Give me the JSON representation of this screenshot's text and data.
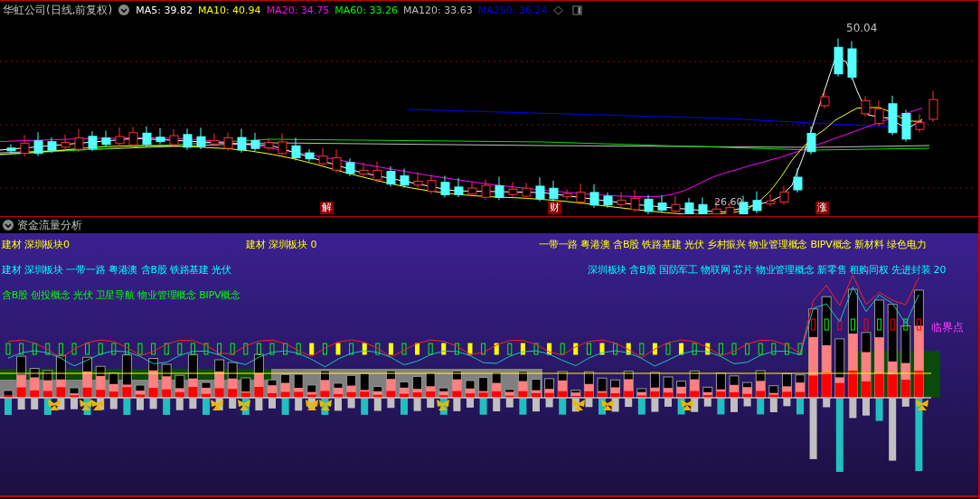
{
  "header": {
    "title": "华虹公司(日线,前复权)",
    "ma": [
      {
        "label": "MA5: 39.82",
        "color": "#ffffff"
      },
      {
        "label": "MA10: 40.94",
        "color": "#ffff00"
      },
      {
        "label": "MA20: 34.75",
        "color": "#ff00ff"
      },
      {
        "label": "MA60: 33.26",
        "color": "#00ff00"
      },
      {
        "label": "MA120: 33.63",
        "color": "#c0c0c0"
      },
      {
        "label": "MA250: 36.24",
        "color": "#0000ff"
      }
    ]
  },
  "price_chart": {
    "high_label": "50.04",
    "low_label": "26.60",
    "markers": [
      "解",
      "财",
      "涨"
    ]
  },
  "flow_panel": {
    "title": "资金流量分析",
    "rows": [
      {
        "color": "#ffff00",
        "segments": [
          "建材 深圳板块0",
          "建材 深圳板块 0",
          "一带一路 粤港澳 含B股 铁路基建 光伏 乡村振兴 物业管理概念 BIPV概念 新材料 绿色电力"
        ]
      },
      {
        "color": "#00ffff",
        "segments": [
          "建材 深圳板块 一带一路 粤港澳 含B股 铁路基建 光伏",
          "深圳板块 含B股 国防军工 物联网 芯片 物业管理概念 新零售 租购同权 先进封装 20"
        ]
      },
      {
        "color": "#00ff00",
        "segments": [
          "含B股 创投概念 光伏 卫星导航 物业管理概念 BIPV概念"
        ]
      }
    ],
    "critical_label": "临界点"
  }
}
